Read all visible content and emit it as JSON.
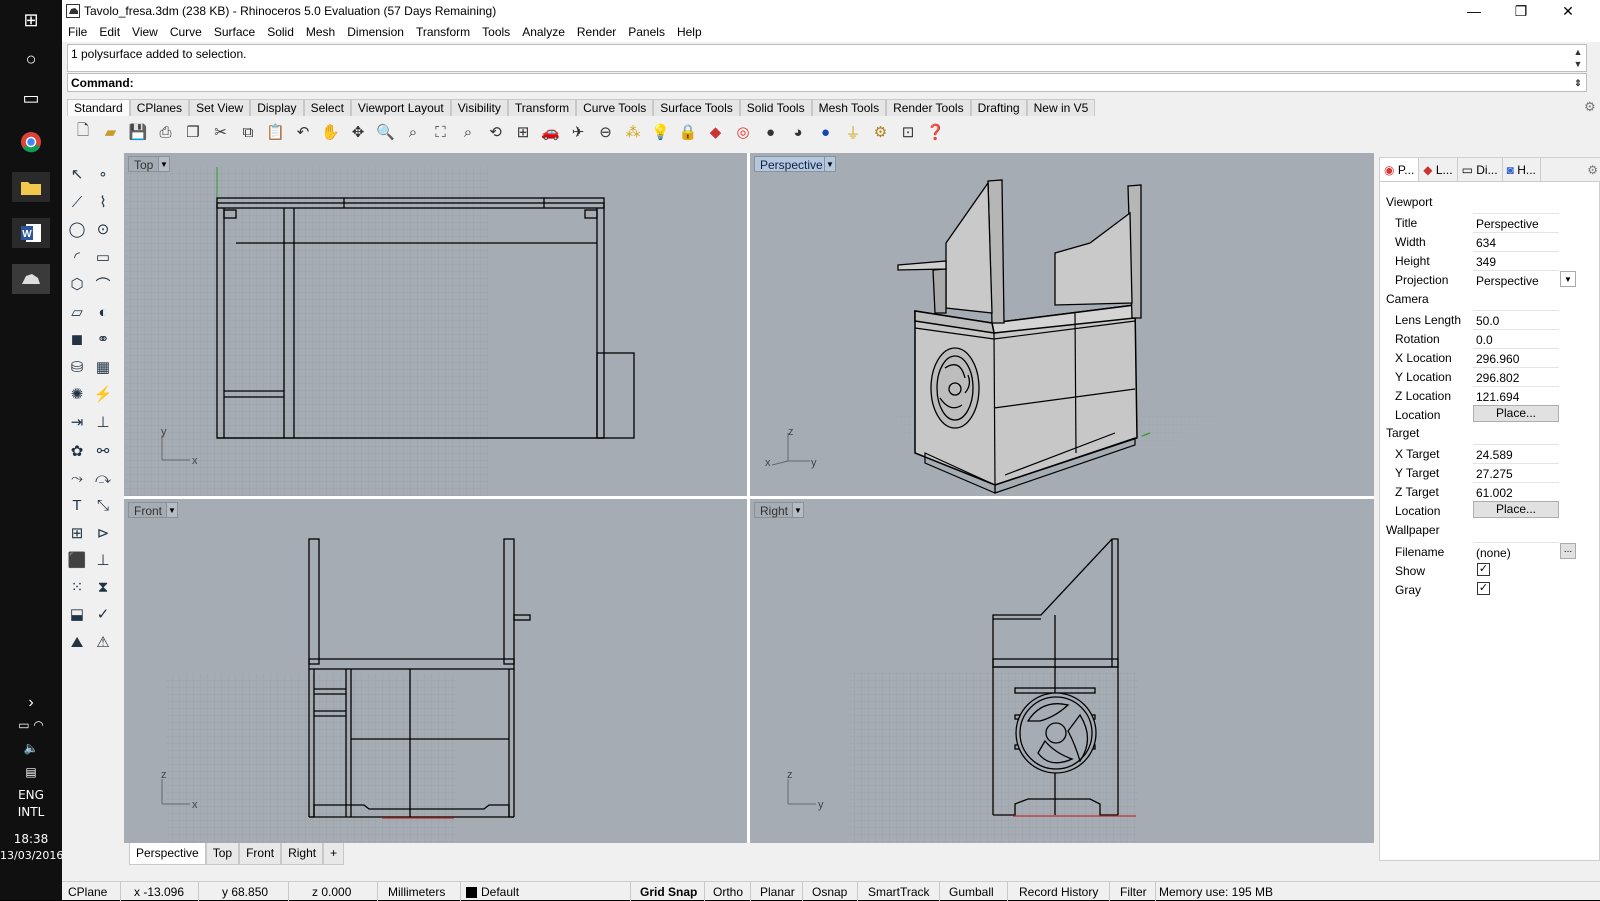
{
  "os": {
    "language": "ENG",
    "layout": "INTL",
    "time": "18:38",
    "date": "13/03/2016"
  },
  "window": {
    "title": "Tavolo_fresa.3dm (238 KB) - Rhinoceros 5.0 Evaluation (57 Days Remaining)",
    "minimize": "—",
    "maximize": "❐",
    "close": "✕"
  },
  "menu": [
    "File",
    "Edit",
    "View",
    "Curve",
    "Surface",
    "Solid",
    "Mesh",
    "Dimension",
    "Transform",
    "Tools",
    "Analyze",
    "Render",
    "Panels",
    "Help"
  ],
  "command": {
    "history": "1 polysurface added to selection.",
    "prompt": "Command:"
  },
  "toolbar_tabs": [
    "Standard",
    "CPlanes",
    "Set View",
    "Display",
    "Select",
    "Viewport Layout",
    "Visibility",
    "Transform",
    "Curve Tools",
    "Surface Tools",
    "Solid Tools",
    "Mesh Tools",
    "Render Tools",
    "Drafting",
    "New in V5"
  ],
  "viewports": {
    "top": "Top",
    "perspective": "Perspective",
    "front": "Front",
    "right": "Right",
    "axis_x": "x",
    "axis_y": "y",
    "axis_z": "z"
  },
  "viewport_tabs": [
    "Perspective",
    "Top",
    "Front",
    "Right"
  ],
  "viewport_tab_add": "+",
  "panel": {
    "tabs": [
      "P...",
      "L...",
      "Di...",
      "H..."
    ],
    "viewport_section": "Viewport",
    "title_label": "Title",
    "title_value": "Perspective",
    "width_label": "Width",
    "width_value": "634",
    "height_label": "Height",
    "height_value": "349",
    "projection_label": "Projection",
    "projection_value": "Perspective",
    "camera_section": "Camera",
    "lens_label": "Lens Length",
    "lens_value": "50.0",
    "rotation_label": "Rotation",
    "rotation_value": "0.0",
    "xloc_label": "X Location",
    "xloc_value": "296.960",
    "yloc_label": "Y Location",
    "yloc_value": "296.802",
    "zloc_label": "Z Location",
    "zloc_value": "121.694",
    "loc_label": "Location",
    "place_button": "Place...",
    "target_section": "Target",
    "xt_label": "X Target",
    "xt_value": "24.589",
    "yt_label": "Y Target",
    "yt_value": "27.275",
    "zt_label": "Z Target",
    "zt_value": "61.002",
    "tloc_label": "Location",
    "wallpaper_section": "Wallpaper",
    "filename_label": "Filename",
    "filename_value": "(none)",
    "filename_button": "...",
    "show_label": "Show",
    "gray_label": "Gray"
  },
  "status": {
    "cplane": "CPlane",
    "x": "x -13.096",
    "y": "y 68.850",
    "z": "z 0.000",
    "units": "Millimeters",
    "layer": "Default",
    "grid_snap": "Grid Snap",
    "ortho": "Ortho",
    "planar": "Planar",
    "osnap": "Osnap",
    "smarttrack": "SmartTrack",
    "gumball": "Gumball",
    "record_history": "Record History",
    "filter": "Filter",
    "memory": "Memory use: 195 MB"
  },
  "colors": {
    "viewport_bg": "#a6acb4",
    "active_label": "#b3c7df",
    "grid": "#959ba3"
  }
}
